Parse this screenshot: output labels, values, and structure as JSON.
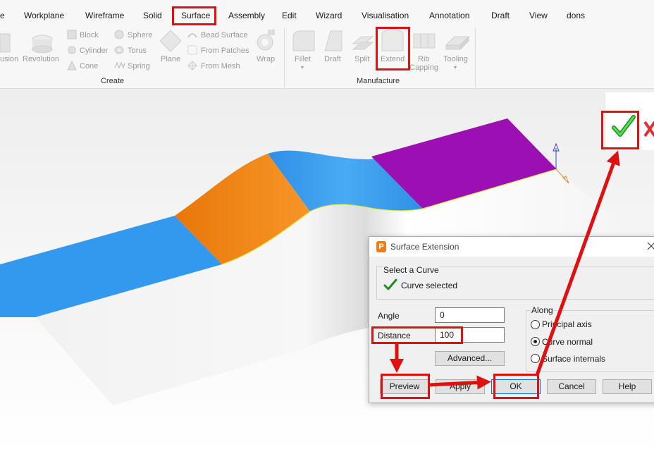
{
  "menubar": {
    "tabs": [
      {
        "label": "e"
      },
      {
        "label": "Workplane"
      },
      {
        "label": "Wireframe"
      },
      {
        "label": "Solid"
      },
      {
        "label": "Surface"
      },
      {
        "label": "Assembly"
      },
      {
        "label": "Edit"
      },
      {
        "label": "Wizard"
      },
      {
        "label": "Visualisation"
      },
      {
        "label": "Annotation"
      },
      {
        "label": "Draft"
      },
      {
        "label": "View"
      },
      {
        "label": "dons"
      }
    ],
    "active_tab": "Surface"
  },
  "ribbon": {
    "create": {
      "group_label": "Create",
      "extrusion_label": "usion",
      "revolution_label": "Revolution",
      "block_label": "Block",
      "cylinder_label": "Cylinder",
      "cone_label": "Cone",
      "sphere_label": "Sphere",
      "torus_label": "Torus",
      "spring_label": "Spring",
      "plane_label": "Plane",
      "bead_surface_label": "Bead Surface",
      "from_patches_label": "From Patches",
      "from_mesh_label": "From Mesh",
      "wrap_label": "Wrap"
    },
    "manufacture": {
      "group_label": "Manufacture",
      "fillet_label": "Fillet",
      "draft_label": "Draft",
      "split_label": "Split",
      "extend_label": "Extend",
      "rib_label_1": "Rib",
      "rib_label_2": "Capping",
      "tooling_label": "Tooling"
    }
  },
  "dialog": {
    "title": "Surface Extension",
    "select_curve_heading": "Select a Curve",
    "curve_status": "Curve selected",
    "angle_label": "Angle",
    "angle_value": "0",
    "distance_label": "Distance",
    "distance_value": "100",
    "advanced_button": "Advanced...",
    "along_heading": "Along",
    "along_options": [
      {
        "label": "Principal axis",
        "selected": false
      },
      {
        "label": "Curve normal",
        "selected": true
      },
      {
        "label": "Surface internals",
        "selected": false
      }
    ],
    "buttons": {
      "preview": "Preview",
      "apply": "Apply",
      "ok": "OK",
      "cancel": "Cancel",
      "help": "Help"
    }
  },
  "colors": {
    "highlight": "#e01010",
    "surface_blue": "#3399ee",
    "surface_orange": "#f07e10",
    "surface_purple": "#9b0fb3",
    "accept_green": "#33bb33",
    "reject_red": "#e03030"
  },
  "icons": [
    "accept-check-icon",
    "reject-cross-icon",
    "close-icon",
    "app-logo-icon",
    "curve-selected-check-icon",
    "axis-triad-icon"
  ]
}
